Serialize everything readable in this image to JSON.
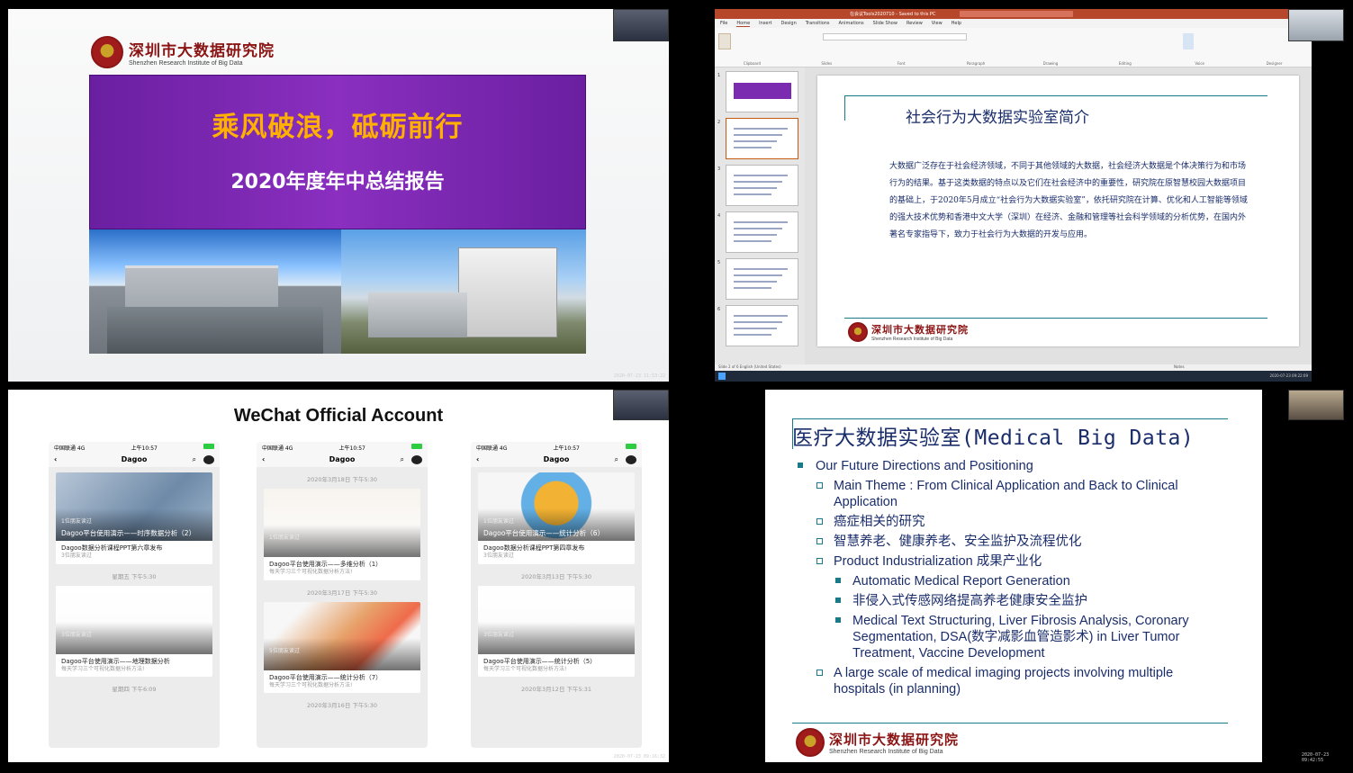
{
  "q1": {
    "logo_cn": "深圳市大数据研究院",
    "logo_en": "Shenzhen Research Institute of Big Data",
    "title": "乘风破浪，砥砺前行",
    "subtitle": "2020年度年中总结报告",
    "timestamp": "2020-07-23 11:53:22"
  },
  "q2": {
    "app_title": "在会议Tools2020710 - Saved to this PC",
    "menu": [
      "File",
      "Home",
      "Insert",
      "Design",
      "Transitions",
      "Animations",
      "Slide Show",
      "Review",
      "View",
      "Help"
    ],
    "ribbon_groups": [
      "Clipboard",
      "Slides",
      "Font",
      "Paragraph",
      "Drawing",
      "Editing",
      "Voice",
      "Designer"
    ],
    "slide_numbers": [
      "1",
      "2",
      "3",
      "4",
      "5",
      "6"
    ],
    "slide_title": "社会行为大数据实验室简介",
    "slide_body": "大数据广泛存在于社会经济领域，不同于其他领域的大数据，社会经济大数据是个体决策行为和市场行为的结果。基于这类数据的特点以及它们在社会经济中的重要性，研究院在原智慧校园大数据项目的基础上，于2020年5月成立“社会行为大数据实验室”，依托研究院在计算、优化和人工智能等领域的强大技术优势和香港中文大学（深圳）在经济、金融和管理等社会科学领域的分析优势，在国内外著名专家指导下，致力于社会行为大数据的开发与应用。",
    "logo_cn": "深圳市大数据研究院",
    "logo_en": "Shenzhen Research Institute of Big Data",
    "status": "Slide 2 of 6   English (United States)",
    "notes": "Notes",
    "timestamp": "2020-07-23 09:22:09"
  },
  "q3": {
    "title": "WeChat Official Account",
    "timestamp": "2020-07-23 09:16:32",
    "phones": [
      {
        "carrier": "中国联通 4G",
        "time": "上午10:57",
        "nav": "Dagoo",
        "cards": [
          {
            "read": "1位朋友读过",
            "caption": "Dagoo平台使用演示——时序数据分析（2）",
            "body": "Dagoo数据分析课程PPT第六章发布",
            "sub": "3位朋友读过"
          },
          {
            "sep": "星期五 下午5:30",
            "read": "3位朋友读过",
            "caption": "",
            "body": "Dagoo平台使用演示——地理数据分析",
            "sub": "每天学习三个可视化数据分析方法!"
          }
        ],
        "footer": "星期四 下午6:09"
      },
      {
        "carrier": "中国联通 4G",
        "time": "上午10:57",
        "nav": "Dagoo",
        "cards": [
          {
            "sep": "2020年3月18日 下午5:30",
            "read": "1位朋友读过",
            "caption": "",
            "body": "Dagoo平台使用演示——多维分析（1）",
            "sub": "每天学习三个可视化数据分析方法!"
          },
          {
            "sep": "2020年3月17日 下午5:30",
            "read": "5位朋友读过",
            "caption": "",
            "body": "Dagoo平台使用演示——统计分析（7）",
            "sub": "每天学习三个可视化数据分析方法!"
          }
        ],
        "footer": "2020年3月16日 下午5:30"
      },
      {
        "carrier": "中国联通 4G",
        "time": "上午10:57",
        "nav": "Dagoo",
        "cards": [
          {
            "read": "1位朋友读过",
            "caption": "Dagoo平台使用演示——统计分析（6）",
            "body": "Dagoo数据分析课程PPT第四章发布",
            "sub": "3位朋友读过"
          },
          {
            "sep": "2020年3月13日 下午5:30",
            "read": "3位朋友读过",
            "caption": "",
            "body": "Dagoo平台使用演示——统计分析（5）",
            "sub": "每天学习三个可视化数据分析方法!"
          }
        ],
        "footer": "2020年3月12日 下午5:31"
      }
    ]
  },
  "q4": {
    "title": "医疗大数据实验室(Medical Big Data)",
    "items": [
      {
        "level": "l1",
        "text": "Our Future Directions and Positioning"
      },
      {
        "level": "l2",
        "text": "Main Theme : From Clinical Application and Back to Clinical Application"
      },
      {
        "level": "l2",
        "text": "癌症相关的研究"
      },
      {
        "level": "l2",
        "text": "智慧养老、健康养老、安全监护及流程优化"
      },
      {
        "level": "l2",
        "text": "Product Industrialization 成果产业化"
      },
      {
        "level": "l3",
        "text": "Automatic Medical Report Generation"
      },
      {
        "level": "l3",
        "text": "非侵入式传感网络提高养老健康安全监护"
      },
      {
        "level": "l3",
        "text": "Medical Text Structuring, Liver Fibrosis Analysis,  Coronary Segmentation,  DSA(数字减影血管造影术) in Liver Tumor Treatment,  Vaccine Development"
      },
      {
        "level": "l2",
        "text": "A large scale of medical imaging projects involving multiple hospitals (in planning)"
      }
    ],
    "logo_cn": "深圳市大数据研究院",
    "logo_en": "Shenzhen Research Institute of Big Data",
    "timestamp": "2020-07-23 09:42:55"
  }
}
